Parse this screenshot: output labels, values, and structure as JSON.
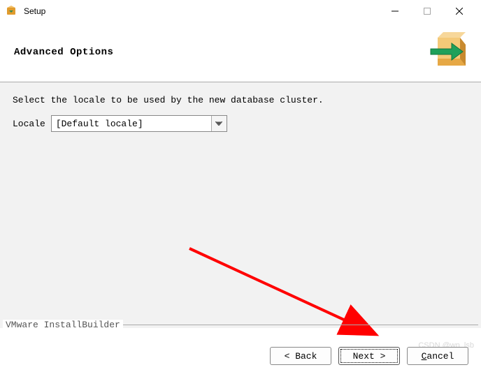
{
  "window": {
    "title": "Setup"
  },
  "header": {
    "title": "Advanced Options"
  },
  "content": {
    "instruction": "Select the locale to be used by the new database cluster.",
    "locale_label": "Locale",
    "locale_value": "[Default locale]"
  },
  "footer": {
    "builder_label": "VMware InstallBuilder",
    "back": "< Back",
    "next": "Next >",
    "cancel_prefix": "",
    "cancel_u": "C",
    "cancel_rest": "ancel"
  },
  "watermark": "CSDN @wn_lsb"
}
